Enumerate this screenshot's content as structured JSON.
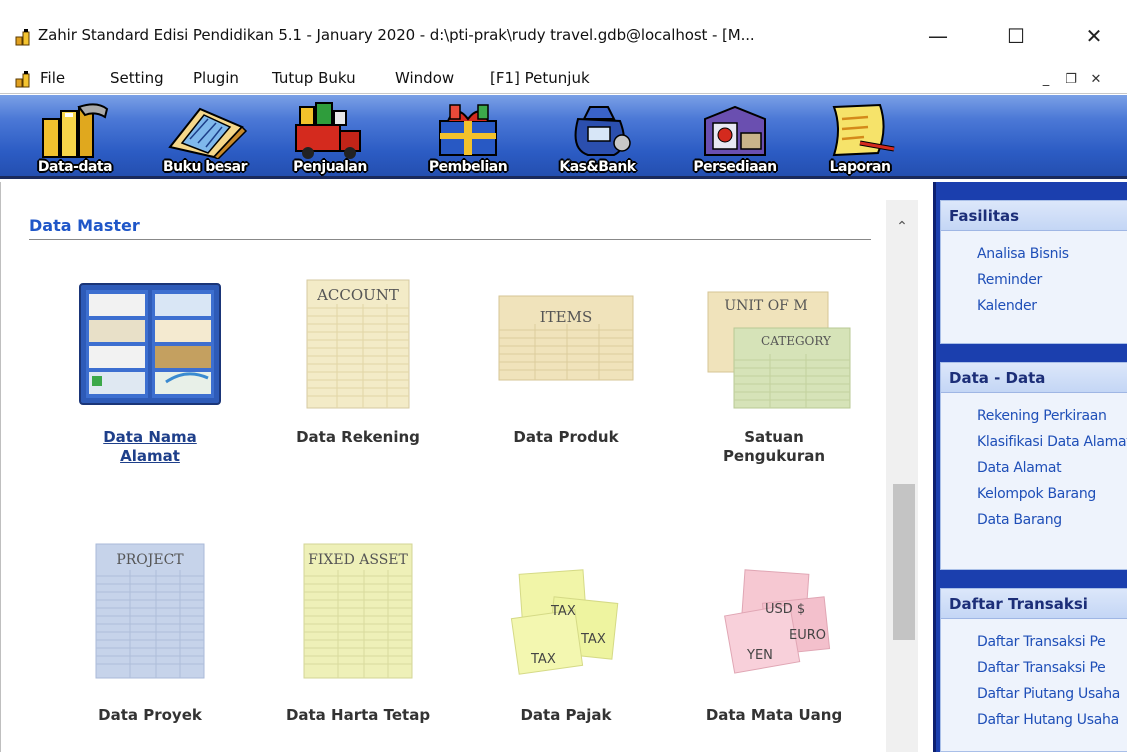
{
  "window": {
    "title": "Zahir Standard Edisi Pendidikan 5.1 - January 2020 - d:\\pti-prak\\rudy travel.gdb@localhost - [M...",
    "minimize_glyph": "—",
    "maximize_glyph": "☐",
    "close_glyph": "✕"
  },
  "menu": {
    "items": [
      "File",
      "Setting",
      "Plugin",
      "Tutup Buku",
      "Window",
      "[F1] Petunjuk"
    ],
    "mdi_minimize": "_",
    "mdi_restore": "❐",
    "mdi_close": "✕"
  },
  "toolbar": {
    "items": [
      {
        "label": "Data-data",
        "icon": "binders-icon"
      },
      {
        "label": "Buku besar",
        "icon": "ledger-icon"
      },
      {
        "label": "Penjualan",
        "icon": "truck-gifts-icon"
      },
      {
        "label": "Pembelian",
        "icon": "gift-box-icon"
      },
      {
        "label": "Kas&Bank",
        "icon": "money-bag-icon"
      },
      {
        "label": "Persediaan",
        "icon": "warehouse-box-icon"
      },
      {
        "label": "Laporan",
        "icon": "report-scroll-icon"
      }
    ]
  },
  "main": {
    "section_title": "Data Master",
    "cards": [
      {
        "label": "Data Nama Alamat",
        "line1": "Data Nama",
        "line2": "Alamat",
        "thumb_text": "",
        "is_link": true
      },
      {
        "label": "Data Rekening",
        "line1": "Data Rekening",
        "line2": "",
        "thumb_text": "ACCOUNT",
        "is_link": false
      },
      {
        "label": "Data Produk",
        "line1": "Data Produk",
        "line2": "",
        "thumb_text": "ITEMS",
        "is_link": false
      },
      {
        "label": "Satuan Pengukuran",
        "line1": "Satuan",
        "line2": "Pengukuran",
        "thumb_text": "UNIT OF M",
        "thumb_text2": "CATEGORY",
        "is_link": false
      },
      {
        "label": "Data Proyek",
        "line1": "Data Proyek",
        "line2": "",
        "thumb_text": "PROJECT",
        "is_link": false
      },
      {
        "label": "Data Harta Tetap",
        "line1": "Data Harta Tetap",
        "line2": "",
        "thumb_text": "FIXED ASSET",
        "is_link": false
      },
      {
        "label": "Data Pajak",
        "line1": "Data Pajak",
        "line2": "",
        "thumb_notes": [
          "TAX",
          "TAX",
          "TAX"
        ],
        "is_link": false
      },
      {
        "label": "Data Mata Uang",
        "line1": "Data Mata Uang",
        "line2": "",
        "thumb_notes": [
          "USD $",
          "EURO",
          "YEN"
        ],
        "is_link": false
      }
    ]
  },
  "sidebar": {
    "panels": [
      {
        "title": "Fasilitas",
        "items": [
          "Analisa Bisnis",
          "Reminder",
          "Kalender"
        ]
      },
      {
        "title": "Data - Data",
        "items": [
          "Rekening Perkiraan",
          "Klasifikasi Data Alamat",
          "Data Alamat",
          "Kelompok Barang",
          "Data Barang"
        ]
      },
      {
        "title": "Daftar Transaksi",
        "items": [
          "Daftar Transaksi Pe",
          "Daftar Transaksi Pe",
          "Daftar Piutang Usaha",
          "Daftar Hutang Usaha"
        ]
      }
    ]
  },
  "colors": {
    "toolbar_blue": "#2c5cc4",
    "section_title": "#1f56c8",
    "link": "#1f4fb8"
  }
}
